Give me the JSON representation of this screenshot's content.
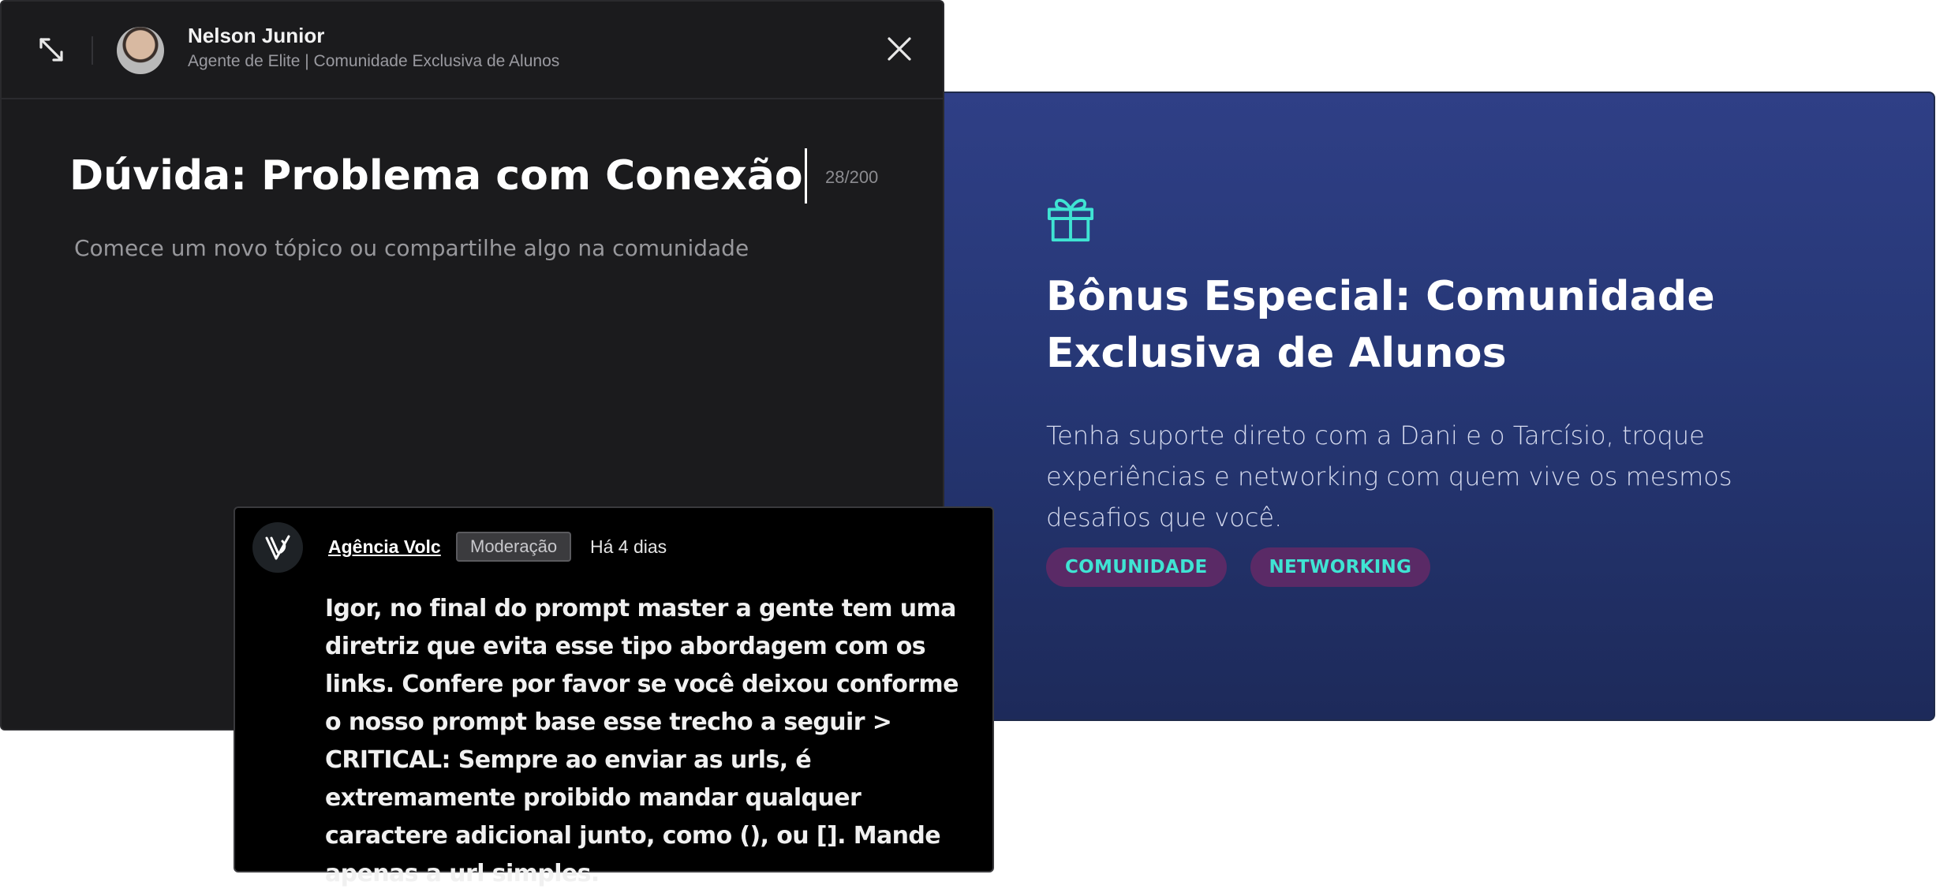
{
  "editor": {
    "author_name": "Nelson Junior",
    "author_subtitle": "Agente de Elite | Comunidade Exclusiva de Alunos",
    "title_value": "Dúvida: Problema com Conexão",
    "char_counter": "28/200",
    "body_placeholder": "Comece um novo tópico ou compartilhe algo na comunidade",
    "icons": {
      "expand": "expand-arrows-icon",
      "close": "close-x-icon"
    }
  },
  "promo": {
    "icon": "gift-icon",
    "title": "Bônus Especial: Comunidade Exclusiva de Alunos",
    "description": "Tenha suporte direto com a Dani e o Tarcísio, troque experiências e networking com quem vive os mesmos desafios que você.",
    "tags": [
      "COMUNIDADE",
      "NETWORKING"
    ],
    "colors": {
      "background": "#2b3a7e",
      "tag_bg": "#5a2a66",
      "tag_text": "#3fe4d3",
      "icon": "#3fe4d3"
    }
  },
  "comment": {
    "author": "Agência Volc",
    "badge": "Moderação",
    "time": "Há 4 dias",
    "text": "Igor, no final do prompt master a gente tem uma diretriz que evita esse tipo abordagem com os links. Confere por favor se você deixou conforme o nosso prompt base esse trecho a seguir > CRITICAL: Sempre ao enviar as urls, é extremamente proibido mandar qualquer caractere adicional junto, como (), ou []. Mande apenas a url simples."
  }
}
